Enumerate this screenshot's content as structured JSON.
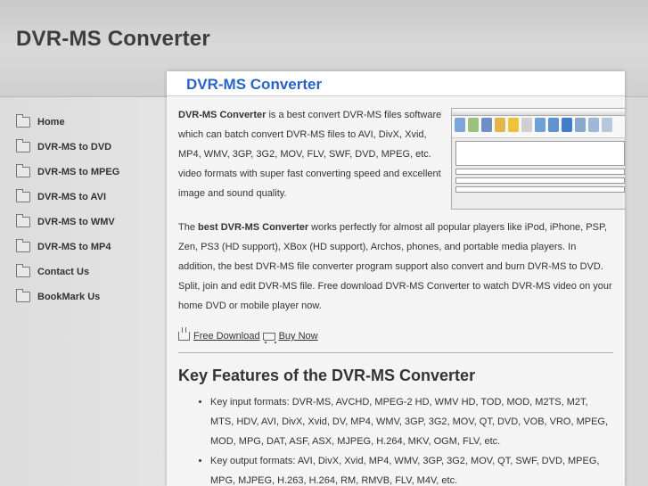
{
  "site": {
    "title": "DVR-MS Converter"
  },
  "nav": [
    {
      "label": "Home",
      "icon": "folder-icon"
    },
    {
      "label": "DVR-MS to DVD",
      "icon": "folder-icon"
    },
    {
      "label": "DVR-MS to MPEG",
      "icon": "folder-icon"
    },
    {
      "label": "DVR-MS to AVI",
      "icon": "folder-icon"
    },
    {
      "label": "DVR-MS to WMV",
      "icon": "folder-icon"
    },
    {
      "label": "DVR-MS to MP4",
      "icon": "folder-icon"
    },
    {
      "label": "Contact Us",
      "icon": "folder-icon"
    },
    {
      "label": "BookMark Us",
      "icon": "folder-icon"
    }
  ],
  "main": {
    "heading": "DVR-MS Converter",
    "intro_bold": "DVR-MS Converter",
    "intro_rest": " is a best convert DVR-MS files software which can batch convert DVR-MS files to AVI, DivX, Xvid, MP4, WMV, 3GP, 3G2, MOV, FLV, SWF, DVD, MPEG, etc. video formats with super fast converting speed and excellent image and sound quality.",
    "p2_pre": "The ",
    "p2_bold": "best DVR-MS Converter",
    "p2_rest": " works perfectly for almost all popular players like iPod, iPhone, PSP, Zen, PS3 (HD support), XBox (HD support), Archos, phones, and portable media players. In addition, the best DVR-MS file converter program support also convert and burn DVR-MS to DVD. Split, join and edit DVR-MS file. Free download DVR-MS Converter to watch DVR-MS video on your home DVD or mobile player now.",
    "free_download": "Free Download",
    "buy_now": "Buy Now",
    "features_title": "Key Features of the DVR-MS Converter",
    "features": [
      "Key input formats: DVR-MS, AVCHD, MPEG-2 HD, WMV HD, TOD, MOD, M2TS, M2T, MTS, HDV, AVI, DivX, Xvid, DV, MP4, WMV, 3GP, 3G2, MOV, QT, DVD, VOB, VRO, MPEG, MOD, MPG, DAT, ASF, ASX, MJPEG, H.264, MKV, OGM, FLV, etc.",
      "Key output formats: AVI, DivX, Xvid, MP4, WMV, 3GP, 3G2, MOV, QT, SWF, DVD, MPEG, MPG, MJPEG, H.263, H.264, RM, RMVB, FLV, M4V, etc."
    ]
  },
  "colors": {
    "heading_blue": "#2a64c8",
    "text": "#333333",
    "panel": "#f4f4f4"
  }
}
